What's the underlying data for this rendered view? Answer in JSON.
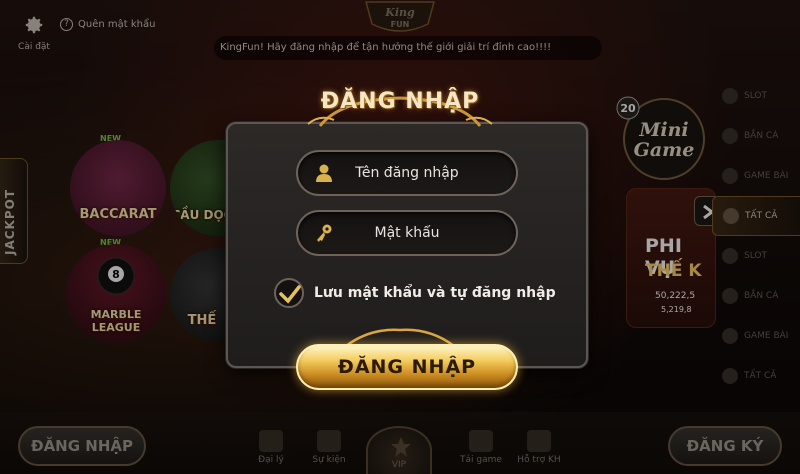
{
  "topbar": {
    "settings_label": "Cài đặt",
    "forgot_password_label": "Quên mật khẩu",
    "logo_text": "KING FUN",
    "marquee_text": "KingFun! Hãy đăng nhập để tận hưởng thế giới giải trí đỉnh cao!!!!"
  },
  "lobby": {
    "jackpot_label": "JACKPOT",
    "new_badge": "NEW",
    "games": [
      "BACCARAT",
      "CẦU DỌC",
      "MARBLE LEAGUE",
      "THẾ"
    ],
    "right_menu": [
      "SLOT",
      "BẮN CÁ",
      "GAME BÀI",
      "TẤT CẢ",
      "SLOT",
      "BẮN CÁ",
      "GAME BÀI",
      "TẤT CẢ"
    ],
    "minigame_label": "Mini Game",
    "minigame_badge": "20",
    "featured_title_1": "PHI VỤ",
    "featured_title_2": "THẾ K",
    "featured_value_1": "50,222,5",
    "featured_value_2": "5,219,8"
  },
  "bottom": {
    "login_label": "ĐĂNG NHẬP",
    "register_label": "ĐĂNG KÝ",
    "nav": [
      "Đại lý",
      "Sự kiện",
      "VIP",
      "Tải game",
      "Hỗ trợ KH"
    ]
  },
  "login_dialog": {
    "title": "ĐĂNG NHẬP",
    "username_placeholder": "Tên đăng nhập",
    "password_placeholder": "Mật khẩu",
    "remember_label": "Lưu mật khẩu và tự đăng nhập",
    "remember_checked": true,
    "submit_label": "ĐĂNG NHẬP"
  },
  "colors": {
    "gold": "#f3cb5c",
    "dialog_bg": "#2c2927",
    "field_border": "#6e6358"
  },
  "icons": [
    "gear-icon",
    "question-icon",
    "user-icon",
    "key-icon",
    "checkmark-icon",
    "chevron-right-icon"
  ]
}
